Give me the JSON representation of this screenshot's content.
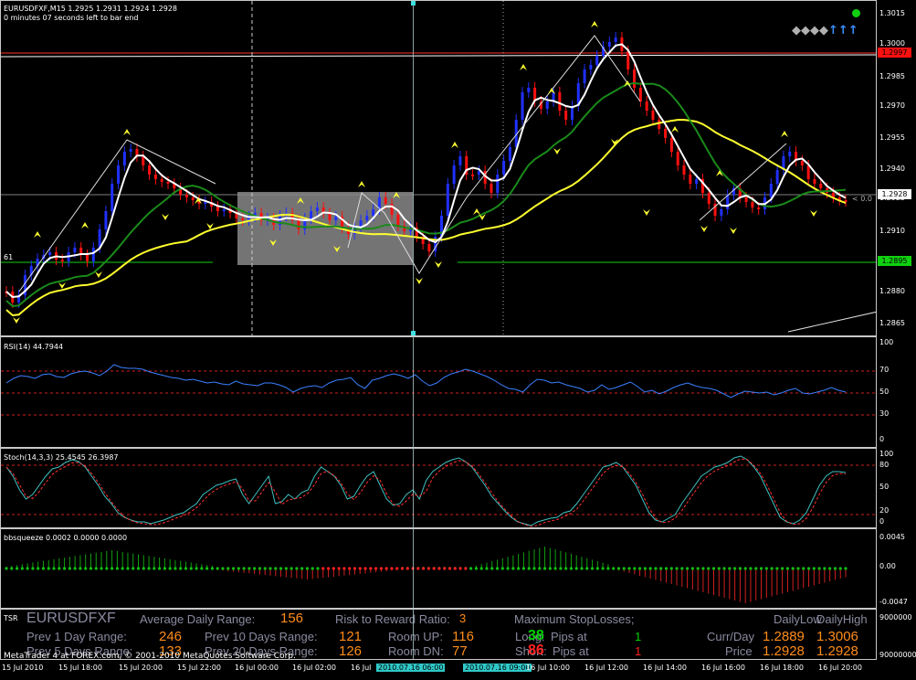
{
  "chart": {
    "title": "EURUSDFXF,M15  1.2925 1.2931 1.2924 1.2928",
    "countdown": "0 minutes 07 seconds left to bar end",
    "left_marker": "61",
    "right_note": "< 0.0",
    "price_ticks": [
      "1.3015",
      "1.3000",
      "1.2985",
      "1.2970",
      "1.2955",
      "1.2940",
      "1.2925",
      "1.2910",
      "1.2895",
      "1.2880",
      "1.2865"
    ],
    "tags": {
      "red_line": "1.2997",
      "current": "1.2928",
      "green_line": "1.2895"
    }
  },
  "rsi": {
    "title": "RSI(14) 44.7944",
    "ticks": [
      "100",
      "70",
      "50",
      "30",
      "0"
    ]
  },
  "stoch": {
    "title": "Stoch(14,3,3) 25.4545 26.3987",
    "ticks": [
      "100",
      "80",
      "50",
      "20",
      "0"
    ]
  },
  "bbsqueeze": {
    "title": "bbsqueeze 0.0002 0.0000 0.0000",
    "ticks": [
      "0.0045",
      "0.00",
      "-0.0047"
    ]
  },
  "tsr": {
    "tag": "TSR",
    "ticks": [
      "9000000",
      "90000000"
    ],
    "symbol": "EURUSDFXF",
    "adr_label": "Average Daily Range:",
    "adr_value": "156",
    "rr_label": "Risk to Reward Ratio:",
    "rr_value": "3",
    "msl_label": "Maximum StopLosses;",
    "p1_label": "Prev 1 Day Range:",
    "p1_value": "246",
    "p5_label": "Prev 5 Days Range:",
    "p5_value": "133",
    "p10_label": "Prev 10 Days Range:",
    "p10_value": "121",
    "p20_label": "Prev 20 Days Range:",
    "p20_value": "126",
    "roomup_label": "Room UP:",
    "roomup_value": "116",
    "roomdn_label": "Room DN:",
    "roomdn_value": "77",
    "long_label": "Long:",
    "long_mid": "Pips at",
    "long_pips": "38",
    "long_count": "1",
    "short_label": "Short:",
    "short_mid": "Pips at",
    "short_pips": "86",
    "short_count": "1",
    "dlow_label": "DailyLow",
    "dhigh_label": "DailyHigh",
    "currday_label": "Curr/Day",
    "currday_low": "1.2889",
    "currday_high": "1.3006",
    "price_label": "Price",
    "price_low": "1.2928",
    "price_high": "1.2928",
    "copyright": "MetaTrader 4 at FOREX.com, © 2001-2010 MetaQuotes Software Corp."
  },
  "time_axis": [
    "15 Jul 2010",
    "15 Jul 18:00",
    "15 Jul 20:00",
    "15 Jul 22:00",
    "16 Jul 00:00",
    "16 Jul 02:00",
    "16 Jul",
    "2010.07.16 06:00",
    "2010.07.16 09:00",
    "16 Jul 10:00",
    "16 Jul 12:00",
    "16 Jul 14:00",
    "16 Jul 16:00",
    "16 Jul 18:00",
    "16 Jul 20:00"
  ],
  "colors": {
    "bull": "#2030ff",
    "bear": "#ff1010",
    "ma_white": "#ffffff",
    "ma_green": "#1a8a1a",
    "ma_yellow": "#ffff30",
    "rsi": "#3a80ff"
  }
}
